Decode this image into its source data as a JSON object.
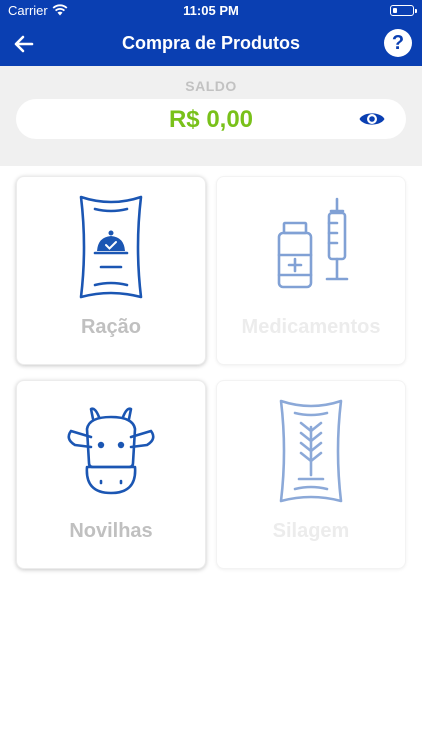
{
  "status_bar": {
    "carrier": "Carrier",
    "time": "11:05 PM"
  },
  "header": {
    "title": "Compra de Produtos",
    "help_label": "?"
  },
  "balance": {
    "label": "SALDO",
    "value": "R$ 0,00"
  },
  "colors": {
    "primary": "#0a3fb2",
    "balance_green": "#79c11a",
    "icon_blue": "#1b56b3"
  },
  "products": [
    {
      "label": "Ração",
      "icon": "feed-bag-icon",
      "enabled": true
    },
    {
      "label": "Medicamentos",
      "icon": "medicine-icon",
      "enabled": false
    },
    {
      "label": "Novilhas",
      "icon": "cow-icon",
      "enabled": true
    },
    {
      "label": "Silagem",
      "icon": "silage-bag-icon",
      "enabled": false
    }
  ]
}
